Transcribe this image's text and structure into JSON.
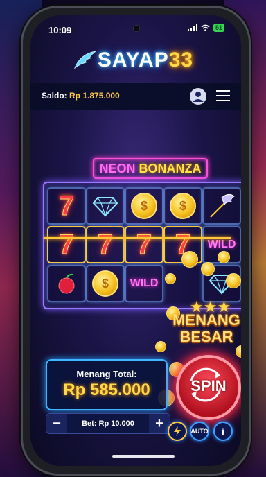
{
  "status_bar": {
    "time": "10:09",
    "battery": "51"
  },
  "brand": {
    "logo_text": "SAYAP",
    "logo_number": "33"
  },
  "header": {
    "saldo_label": "Saldo:",
    "saldo_value": "Rp 1.875.000",
    "account_icon": "user-icon",
    "menu_icon": "hamburger-icon"
  },
  "game": {
    "title_part1": "NEON",
    "title_part2": "BONANZA",
    "reels": [
      [
        "seven",
        "seven",
        "cherry"
      ],
      [
        "diamond",
        "seven",
        "coin"
      ],
      [
        "coin",
        "seven",
        "wild"
      ],
      [
        "coin",
        "seven",
        "blank"
      ],
      [
        "wing-arrow",
        "wild",
        "diamond"
      ]
    ],
    "wild_label": "WILD",
    "coin_symbol": "$",
    "seven_symbol": "7"
  },
  "big_win": {
    "line1": "MENANG",
    "line2": "BESAR",
    "stars": "★★★"
  },
  "win_panel": {
    "label": "Menang Total:",
    "value": "Rp 585.000"
  },
  "bet": {
    "minus": "−",
    "label": "Bet: Rp 10.000",
    "plus": "+"
  },
  "spin": {
    "label": "SPIN"
  },
  "controls": {
    "turbo_icon": "lightning-icon",
    "auto_label": "AUTO",
    "info_label": "i"
  },
  "colors": {
    "accent_gold": "#ffd84a",
    "neon_pink": "#ff4fd8",
    "neon_blue": "#3fb6ff",
    "spin_red": "#d01828"
  }
}
